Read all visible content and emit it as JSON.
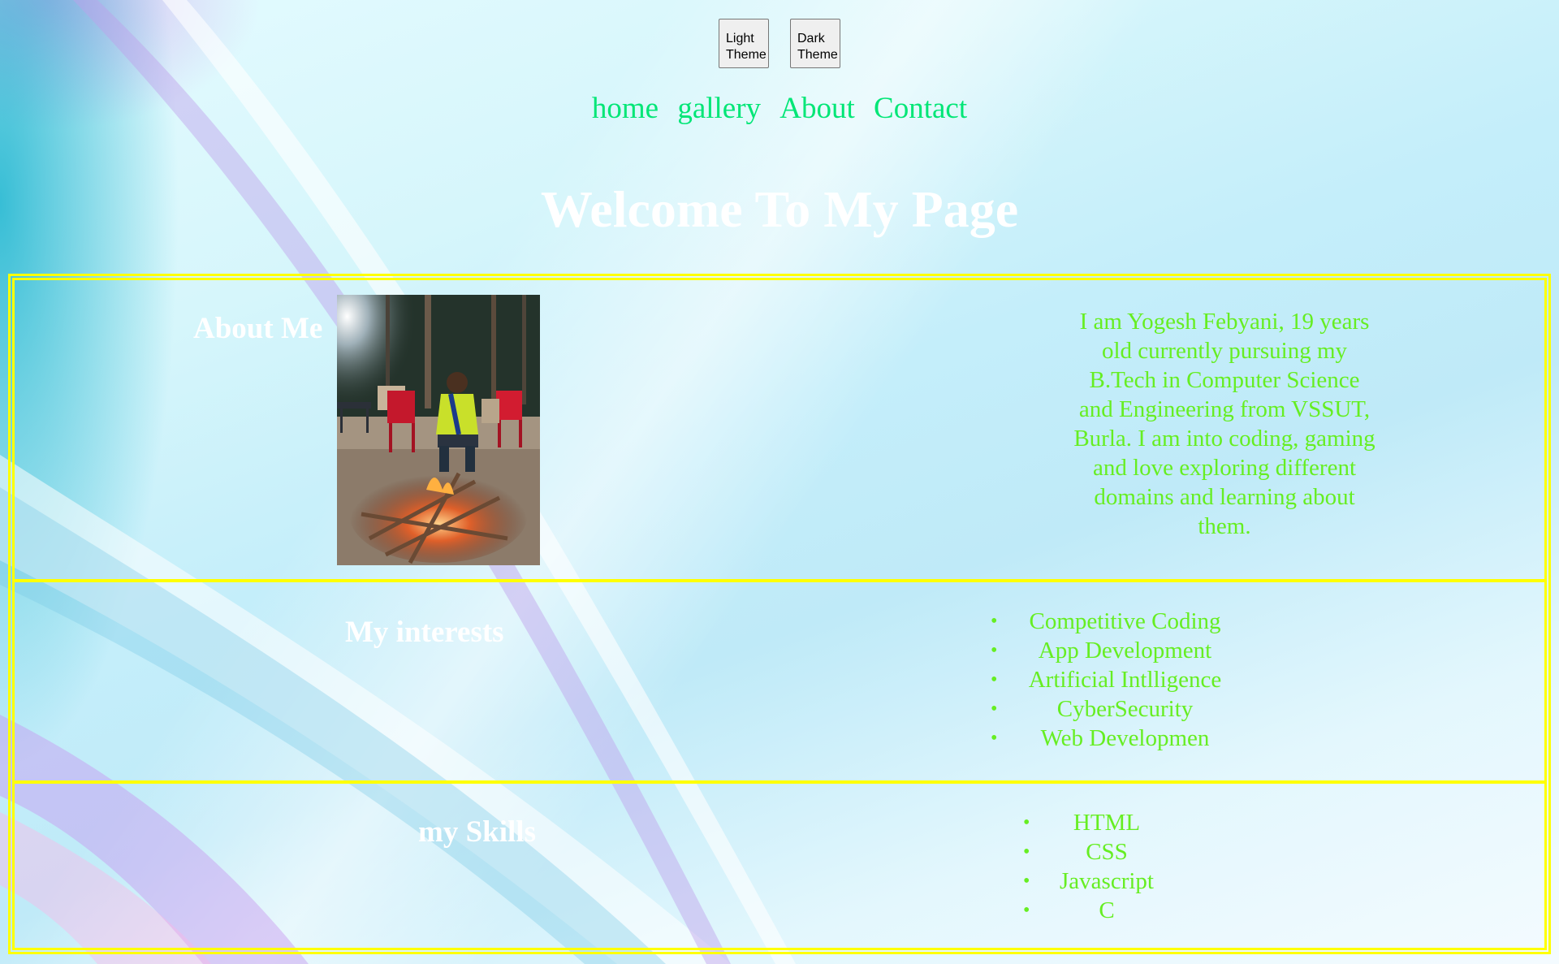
{
  "theme_buttons": {
    "light": "Light Theme",
    "dark": "Dark Theme"
  },
  "nav": {
    "items": [
      "home",
      "gallery",
      "About",
      "Contact"
    ]
  },
  "page_title": "Welcome To My Page",
  "about": {
    "heading": "About Me",
    "bio": "I am Yogesh Febyani, 19 years old currently pursuing my B.Tech in Computer Science and Engineering from VSSUT, Burla. I am into coding, gaming and love exploring different domains and learning about them."
  },
  "interests": {
    "heading": "My interests",
    "items": [
      "Competitive Coding",
      "App Development",
      "Artificial Intlligence",
      "CyberSecurity",
      "Web Developmen"
    ]
  },
  "skills": {
    "heading": "my Skills",
    "items": [
      "HTML",
      "CSS",
      "Javascript",
      "C"
    ]
  },
  "colors": {
    "nav_link": "#00e676",
    "body_text": "#66ee22",
    "border": "#ffff00",
    "heading": "#ffffff"
  }
}
